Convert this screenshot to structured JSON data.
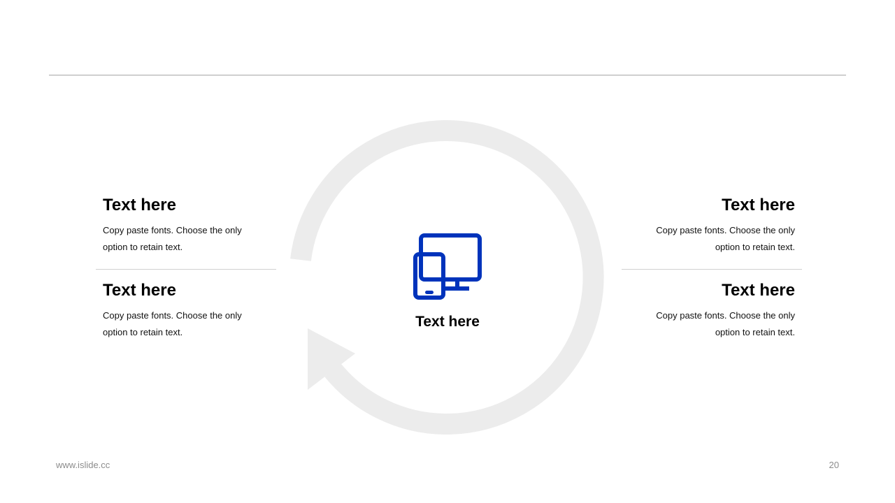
{
  "left_blocks": [
    {
      "heading": "Text here",
      "body": "Copy paste fonts. Choose the only option to retain text."
    },
    {
      "heading": "Text here",
      "body": "Copy paste fonts. Choose the only option to retain text."
    }
  ],
  "right_blocks": [
    {
      "heading": "Text here",
      "body": "Copy paste fonts. Choose the only option to retain text."
    },
    {
      "heading": "Text here",
      "body": "Copy paste fonts. Choose the only option to retain text."
    }
  ],
  "center": {
    "icon": "devices-icon",
    "label": "Text here"
  },
  "footer": {
    "url": "www.islide.cc",
    "page": "20"
  },
  "colors": {
    "accent": "#0033bb",
    "arrow": "#ececec",
    "rule": "#a6a6a6"
  }
}
